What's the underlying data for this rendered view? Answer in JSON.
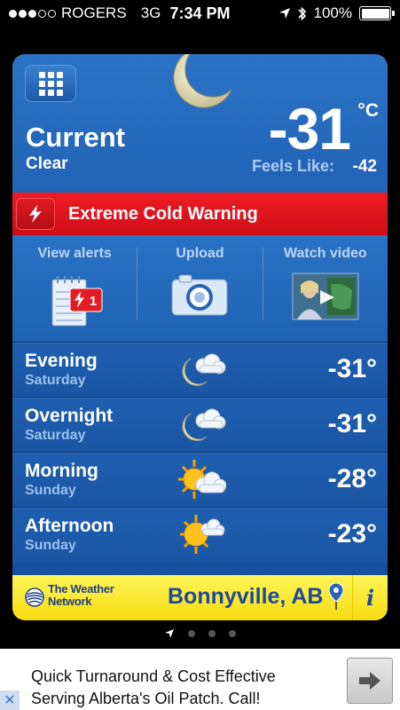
{
  "status_bar": {
    "carrier": "ROGERS",
    "network": "3G",
    "time": "7:34 PM",
    "battery": "100%",
    "battery_level": 1.0,
    "signal_bars_filled": 3,
    "signal_bars_total": 5
  },
  "current": {
    "label": "Current",
    "condition": "Clear",
    "temperature": "-31",
    "unit": "°C",
    "feels_like_label": "Feels Like:",
    "feels_like_value": "-42",
    "icon": "moon-icon"
  },
  "warning": {
    "text": "Extreme Cold Warning",
    "icon": "lightning-icon",
    "color": "#e31b23"
  },
  "actions": [
    {
      "label": "View alerts",
      "icon": "alerts-notepad-icon",
      "badge": "1"
    },
    {
      "label": "Upload",
      "icon": "camera-icon"
    },
    {
      "label": "Watch video",
      "icon": "video-thumbnail-icon"
    }
  ],
  "forecast": [
    {
      "period": "Evening",
      "day": "Saturday",
      "temp": "-31°",
      "icon": "moon-cloud-icon"
    },
    {
      "period": "Overnight",
      "day": "Saturday",
      "temp": "-31°",
      "icon": "moon-cloud-icon"
    },
    {
      "period": "Morning",
      "day": "Sunday",
      "temp": "-28°",
      "icon": "sun-cloud-icon"
    },
    {
      "period": "Afternoon",
      "day": "Sunday",
      "temp": "-23°",
      "icon": "sun-cloud-icon"
    }
  ],
  "footer": {
    "brand_line1": "The Weather",
    "brand_line2": "Network",
    "location": "Bonnyville, AB",
    "info_label": "i"
  },
  "pager": {
    "pages": 4
  },
  "ad": {
    "text_line1": "Quick Turnaround & Cost Effective",
    "text_line2": "Serving Alberta's Oil Patch. Call!",
    "close_label": "✕"
  },
  "colors": {
    "card_blue": "#1d5cae",
    "warning_red": "#e31b23",
    "footer_yellow": "#f9e52a",
    "brand_blue": "#1d4a9a"
  }
}
